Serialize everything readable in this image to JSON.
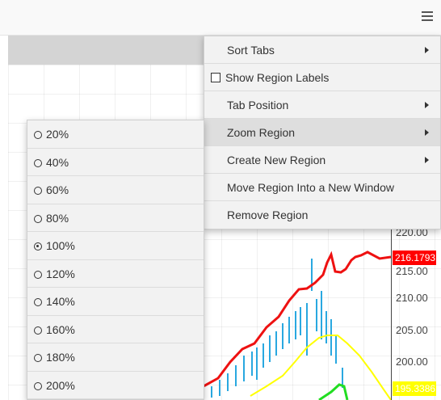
{
  "toolbar": {
    "menu_icon": "hamburger-icon"
  },
  "context_menu": {
    "items": [
      {
        "label": "Sort Tabs",
        "submenu": true
      },
      {
        "label": "Show Region Labels",
        "checkbox": true,
        "checked": false
      },
      {
        "label": "Tab Position",
        "submenu": true
      },
      {
        "label": "Zoom Region",
        "submenu": true,
        "active": true
      },
      {
        "label": "Create New Region",
        "submenu": true
      },
      {
        "label": "Move Region Into a New Window"
      },
      {
        "label": "Remove Region"
      }
    ]
  },
  "zoom_submenu": {
    "selected": "100%",
    "options": [
      "20%",
      "40%",
      "60%",
      "80%",
      "100%",
      "120%",
      "140%",
      "160%",
      "180%",
      "200%"
    ]
  },
  "chart": {
    "y_ticks": [
      "220.00",
      "215.00",
      "210.00",
      "205.00",
      "200.00"
    ],
    "last_price": "216.1793",
    "low_price": "195.3386",
    "colors": {
      "upper_band": "#ee1111",
      "middle_band": "#ffff00",
      "lower_band": "#22dd22",
      "price_bars": "#29a8e0",
      "axis": "#444444"
    }
  }
}
